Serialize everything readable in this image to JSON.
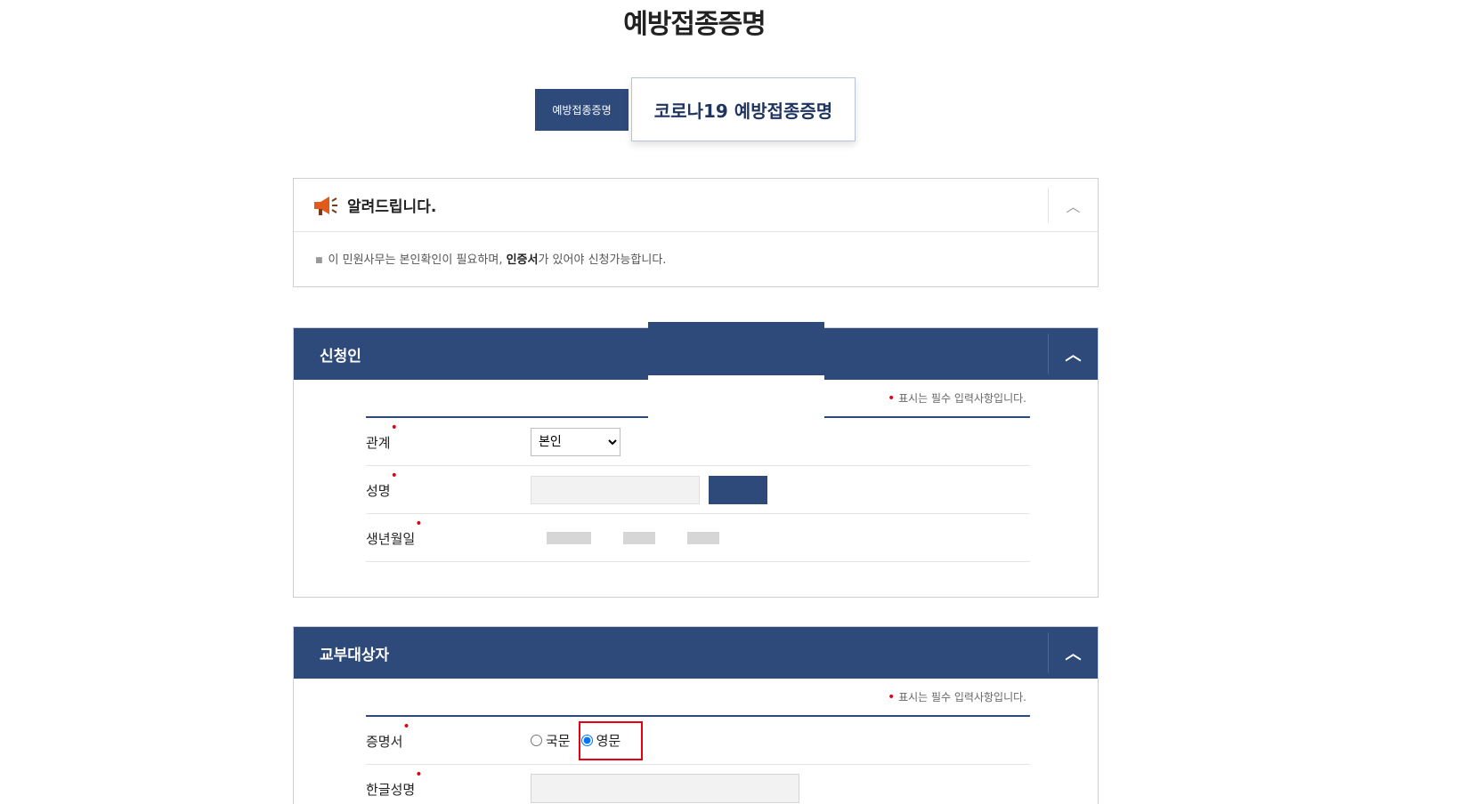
{
  "page": {
    "title": "예방접종증명"
  },
  "tabs": [
    {
      "label": "예방접종증명"
    },
    {
      "label": "코로나19 예방접종증명"
    }
  ],
  "notice": {
    "title": "알려드립니다.",
    "text_before": "이 민원사무는 본인확인이 필요하며, ",
    "text_bold": "인증서",
    "text_after": "가 있어야 신청가능합니다."
  },
  "applicant": {
    "title": "신청인",
    "required_note": "표시는 필수 입력사항입니다.",
    "fields": {
      "relation_label": "관계",
      "relation_value": "본인",
      "name_label": "성명",
      "birth_label": "생년월일"
    }
  },
  "recipient": {
    "title": "교부대상자",
    "required_note": "표시는 필수 입력사항입니다.",
    "fields": {
      "certificate_label": "증명서",
      "option_korean": "국문",
      "option_english": "영문",
      "selected": "영문",
      "korean_name_label": "한글성명"
    }
  },
  "colors": {
    "brand": "#2e4a7a",
    "required": "#e60012"
  },
  "icons": {
    "notice": "megaphone-icon",
    "collapse": "chevron-up-icon"
  }
}
